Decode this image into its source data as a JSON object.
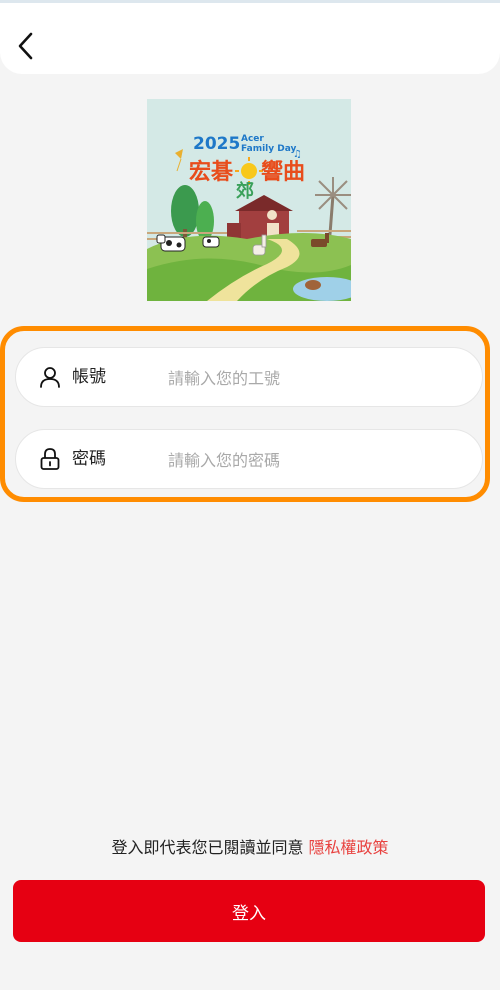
{
  "header": {
    "back_icon": "chevron-left-icon"
  },
  "banner": {
    "year": "2025",
    "brand": "Acer",
    "subtitle": "Family Day",
    "title_line1": "宏碁",
    "title_line2": "響曲",
    "title_line3": "郊"
  },
  "login_form": {
    "account": {
      "icon": "user-icon",
      "label": "帳號",
      "placeholder": "請輸入您的工號",
      "value": ""
    },
    "password": {
      "icon": "lock-icon",
      "label": "密碼",
      "placeholder": "請輸入您的密碼",
      "value": ""
    }
  },
  "consent": {
    "text": "登入即代表您已閱讀並同意",
    "link": "隱私權政策"
  },
  "login_button": {
    "label": "登入"
  },
  "colors": {
    "accent_red": "#e60012",
    "link_red": "#e8423f",
    "highlight_orange": "#ff8c00"
  }
}
